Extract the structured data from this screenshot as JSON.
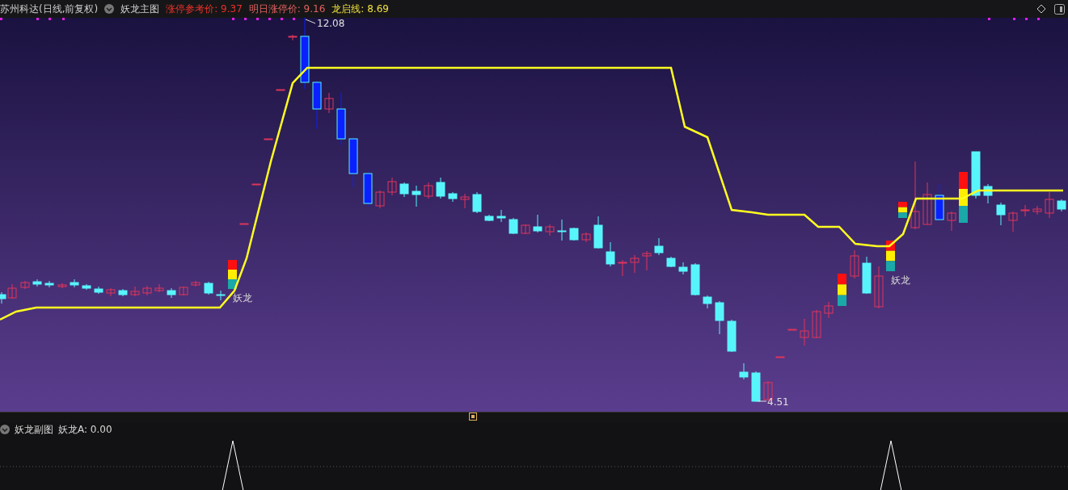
{
  "header": {
    "stock": "苏州科达(日线,前复权)",
    "indicator": "妖龙主图",
    "values": [
      {
        "text": "涨停参考价: 9.37",
        "color": "#e8302a"
      },
      {
        "text": "明日涨停价: 9.16",
        "color": "#e06060"
      },
      {
        "text": "龙启线: 8.69",
        "color": "#f0e040"
      }
    ]
  },
  "main_chart": {
    "high_label": "12.08",
    "low_label": "4.51",
    "signal_labels": [
      "妖龙",
      "妖龙"
    ]
  },
  "sub_chart": {
    "title": "妖龙副图",
    "reading": "妖龙A: 0.00"
  }
}
